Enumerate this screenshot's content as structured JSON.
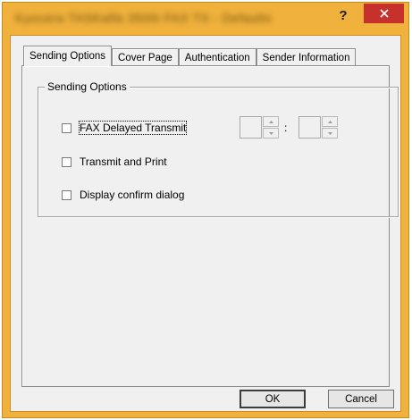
{
  "window": {
    "title": "Kyocera TASKalfa 3500i FAX TX - Defaults",
    "help_label": "?",
    "close_label": "×"
  },
  "tabs": [
    {
      "label": "Sending Options"
    },
    {
      "label": "Cover Page"
    },
    {
      "label": "Authentication"
    },
    {
      "label": "Sender Information"
    }
  ],
  "group": {
    "label": "Sending Options"
  },
  "options": {
    "delayed_transmit": {
      "label": "FAX Delayed Transmit",
      "checked": false
    },
    "transmit_and_print": {
      "label": "Transmit and Print",
      "checked": false
    },
    "confirm_dialog": {
      "label": "Display confirm dialog",
      "checked": false
    }
  },
  "time": {
    "hour": "",
    "minute": "",
    "separator": ":"
  },
  "buttons": {
    "ok": "OK",
    "cancel": "Cancel"
  },
  "colors": {
    "titlebar": "#f0b23c",
    "close": "#c7312b",
    "dialog": "#f0f0f0"
  }
}
